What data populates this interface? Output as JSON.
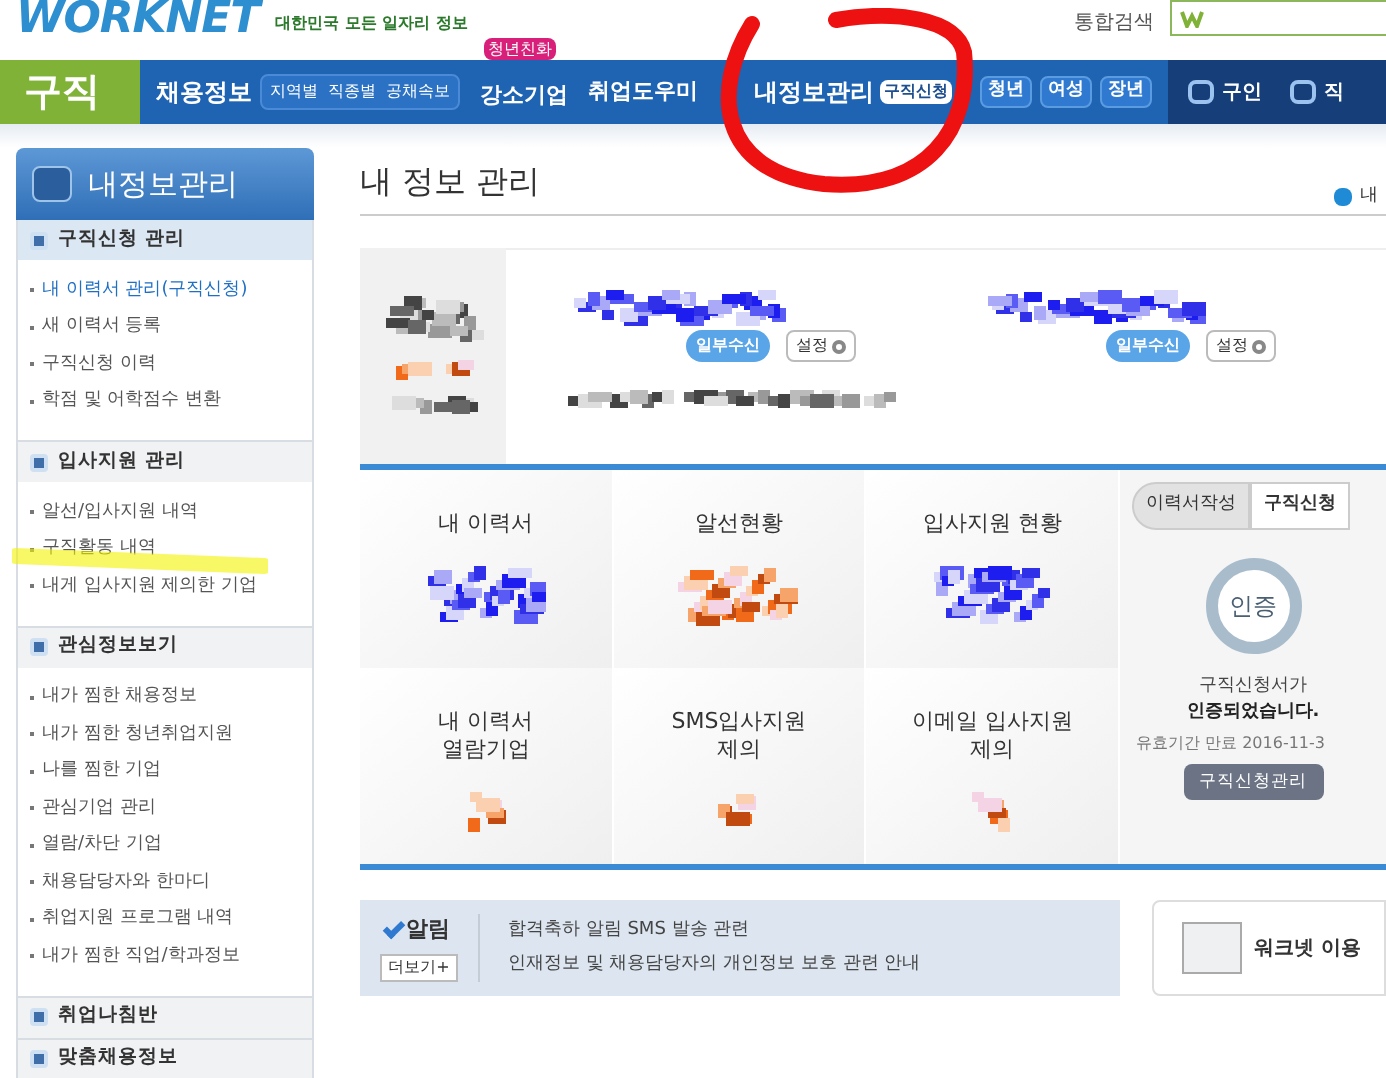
{
  "header": {
    "logo": "WORKNET",
    "tagline": "대한민국 모든 일자리 정보",
    "search_label": "통합검색"
  },
  "nav": {
    "section": "구직",
    "items": [
      {
        "label": "채용정보",
        "kind": "sub",
        "subs": [
          "지역별",
          "직종별",
          "공채속보"
        ]
      },
      {
        "label": "강소기업",
        "kind": "badge",
        "badge": "청년친화"
      },
      {
        "label": "취업도우미",
        "kind": "plain"
      },
      {
        "label": "내정보관리",
        "kind": "tag",
        "tag": "구직신청"
      },
      {
        "label": "청년",
        "kind": "pill"
      },
      {
        "label": "여성",
        "kind": "pill"
      },
      {
        "label": "장년",
        "kind": "pill"
      },
      {
        "label": "구인",
        "kind": "dark"
      },
      {
        "label": "직",
        "kind": "dark"
      }
    ]
  },
  "sidebar": {
    "title": "내정보관리",
    "sections": [
      {
        "title": "구직신청 관리",
        "items": [
          {
            "label": "내 이력서 관리(구직신청)",
            "selected": true
          },
          {
            "label": "새 이력서 등록",
            "selected": false
          },
          {
            "label": "구직신청 이력",
            "selected": false
          },
          {
            "label": "학점 및 어학점수 변환",
            "selected": false
          }
        ]
      },
      {
        "title": "입사지원 관리",
        "items": [
          {
            "label": "알선/입사지원 내역",
            "selected": false
          },
          {
            "label": "구직활동 내역",
            "selected": false
          },
          {
            "label": "내게 입사지원 제의한 기업",
            "selected": false
          }
        ]
      },
      {
        "title": "관심정보보기",
        "items": [
          {
            "label": "내가 찜한 채용정보",
            "selected": false
          },
          {
            "label": "내가 찜한 청년취업지원",
            "selected": false
          },
          {
            "label": "나를 찜한 기업",
            "selected": false
          },
          {
            "label": "관심기업 관리",
            "selected": false
          },
          {
            "label": "열람/차단 기업",
            "selected": false
          },
          {
            "label": "채용담당자와 한마디",
            "selected": false
          },
          {
            "label": "취업지원 프로그램 내역",
            "selected": false
          },
          {
            "label": "내가 찜한 직업/학과정보",
            "selected": false
          }
        ]
      },
      {
        "title": "취업나침반"
      },
      {
        "title": "맞춤채용정보"
      }
    ]
  },
  "page": {
    "title": "내 정보 관리",
    "breadcrumb": "내"
  },
  "profile": {
    "receive": [
      {
        "badge": "일부수신",
        "button": "설정"
      },
      {
        "badge": "일부수신",
        "button": "설정"
      }
    ]
  },
  "stats": [
    "내 이력서",
    "알선현황",
    "입사지원 현황",
    "내 이력서\n열람기업",
    "SMS입사지원\n제의",
    "이메일 입사지원\n제의"
  ],
  "status": {
    "steps": [
      {
        "label": "이력서작성",
        "selected": false
      },
      {
        "label": "구직신청",
        "selected": true
      }
    ],
    "seal": "인증",
    "line1": "구직신청서가",
    "line2": "인증되었습니다.",
    "expiry": "유효기간 만료 2016-11-3",
    "button": "구직신청관리"
  },
  "notice": {
    "title": "알림",
    "more": "더보기+",
    "lines": [
      "합격축하 알림 SMS 발송 관련",
      "인재정보 및 채용담당자의 개인정보 보호 관련 안내"
    ]
  },
  "promo": {
    "text": "워크넷 이용"
  }
}
